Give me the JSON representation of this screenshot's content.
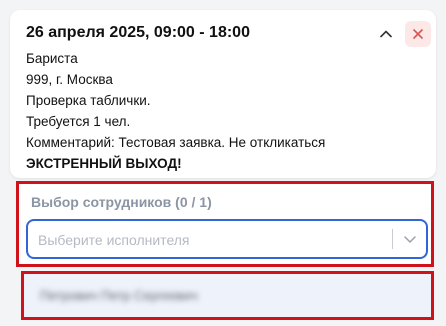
{
  "shift": {
    "title": "26 апреля 2025, 09:00 - 18:00",
    "lines": [
      "Бариста",
      "999, г. Москва",
      "Проверка таблички.",
      "Требуется 1 чел.",
      "Комментарий: Тестовая заявка. Не откликаться",
      "ЭКСТРЕННЫЙ ВЫХОД!"
    ],
    "collapse_icon": "chevron-up-icon",
    "close_icon": "close-icon"
  },
  "employee_selection": {
    "title": "Выбор сотрудников (0 / 1)",
    "select_placeholder": "Выберите исполнителя",
    "select_icon": "chevron-down-icon",
    "employee_name": "Петрович Петр Сергеевич"
  },
  "colors": {
    "highlight_border": "#d0121b",
    "select_focus_border": "#3266d8",
    "close_button_bg": "#fde8e8",
    "close_icon": "#d9534f",
    "muted_text": "#8b95a3"
  }
}
